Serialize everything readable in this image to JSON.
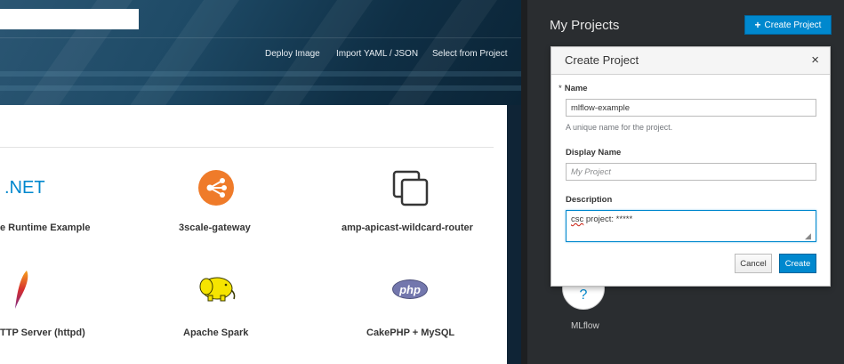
{
  "header": {
    "links": [
      "Deploy Image",
      "Import YAML / JSON",
      "Select from Project"
    ]
  },
  "catalog": {
    "items": [
      {
        "label": "e Runtime Example",
        "icon": "dotnet-icon",
        "icon_text": ".NET"
      },
      {
        "label": "3scale-gateway",
        "icon": "share-icon"
      },
      {
        "label": "amp-apicast-wildcard-router",
        "icon": "copy-icon"
      },
      {
        "label": "TTP Server (httpd)",
        "icon": "feather-icon"
      },
      {
        "label": "Apache Spark",
        "icon": "spark-elephant-icon"
      },
      {
        "label": "CakePHP + MySQL",
        "icon": "php-icon",
        "icon_text": "php"
      }
    ]
  },
  "projects": {
    "title": "My Projects",
    "create_button": "Create Project",
    "items": [
      {
        "label": "MLflow",
        "icon": "question-icon",
        "icon_text": "?"
      }
    ]
  },
  "modal": {
    "title": "Create Project",
    "close": "×",
    "name_label": "Name",
    "required_marker": "*",
    "name_value": "mlflow-example",
    "name_help": "A unique name for the project.",
    "display_name_label": "Display Name",
    "display_name_placeholder": "My Project",
    "description_label": "Description",
    "description_value_part1": "csc",
    "description_value_part2": " project: *****",
    "cancel_label": "Cancel",
    "create_label": "Create"
  },
  "colors": {
    "primary": "#0088ce",
    "panel_dark": "#2a2d30",
    "header_blue": "#1e4a66",
    "icon_orange": "#ef7b2a"
  }
}
